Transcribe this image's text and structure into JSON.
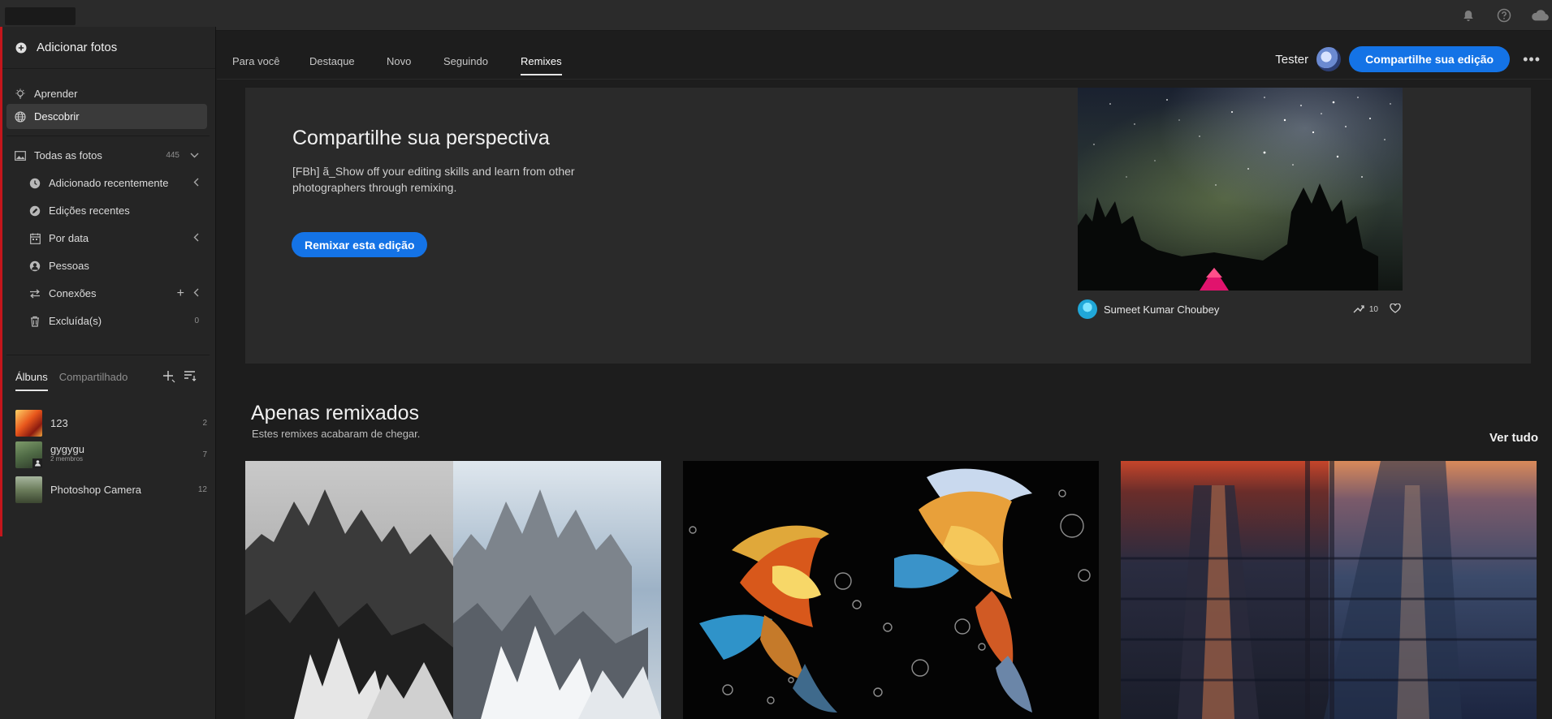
{
  "topbar": {
    "icons": [
      "bell-icon",
      "help-icon",
      "cloud-icon"
    ]
  },
  "sidebar": {
    "add_photos": "Adicionar fotos",
    "items": [
      {
        "label": "Aprender",
        "icon": "lightbulb-icon"
      },
      {
        "label": "Descobrir",
        "icon": "globe-icon",
        "active": true
      }
    ],
    "all_photos": {
      "label": "Todas as fotos",
      "count": "445"
    },
    "library": [
      {
        "label": "Adicionado recentemente",
        "icon": "clock-icon"
      },
      {
        "label": "Edições recentes",
        "icon": "edit-icon"
      },
      {
        "label": "Por data",
        "icon": "calendar-icon"
      },
      {
        "label": "Pessoas",
        "icon": "person-icon"
      },
      {
        "label": "Conexões",
        "icon": "connections-icon"
      },
      {
        "label": "Excluída(s)",
        "icon": "trash-icon",
        "count": "0"
      }
    ],
    "album_tabs": [
      "Álbuns",
      "Compartilhado"
    ],
    "albums": [
      {
        "name": "123",
        "count": "2"
      },
      {
        "name": "gygygu",
        "sub": "2 membros",
        "count": "7"
      },
      {
        "name": "Photoshop Camera",
        "count": "12"
      }
    ]
  },
  "tabs": [
    "Para você",
    "Destaque",
    "Novo",
    "Seguindo",
    "Remixes"
  ],
  "active_tab": "Remixes",
  "header": {
    "user_name": "Tester",
    "share_button": "Compartilhe sua edição",
    "more": "•••"
  },
  "hero": {
    "title": "Compartilhe sua perspectiva",
    "description": "[FBh] ã_Show off your editing skills and learn from other photographers through remixing.",
    "button": "Remixar esta edição",
    "author": "Sumeet Kumar Choubey",
    "remix_count": "10"
  },
  "section": {
    "title": "Apenas remixados",
    "subtitle": "Estes remixes acabaram de chegar.",
    "see_all": "Ver tudo"
  }
}
